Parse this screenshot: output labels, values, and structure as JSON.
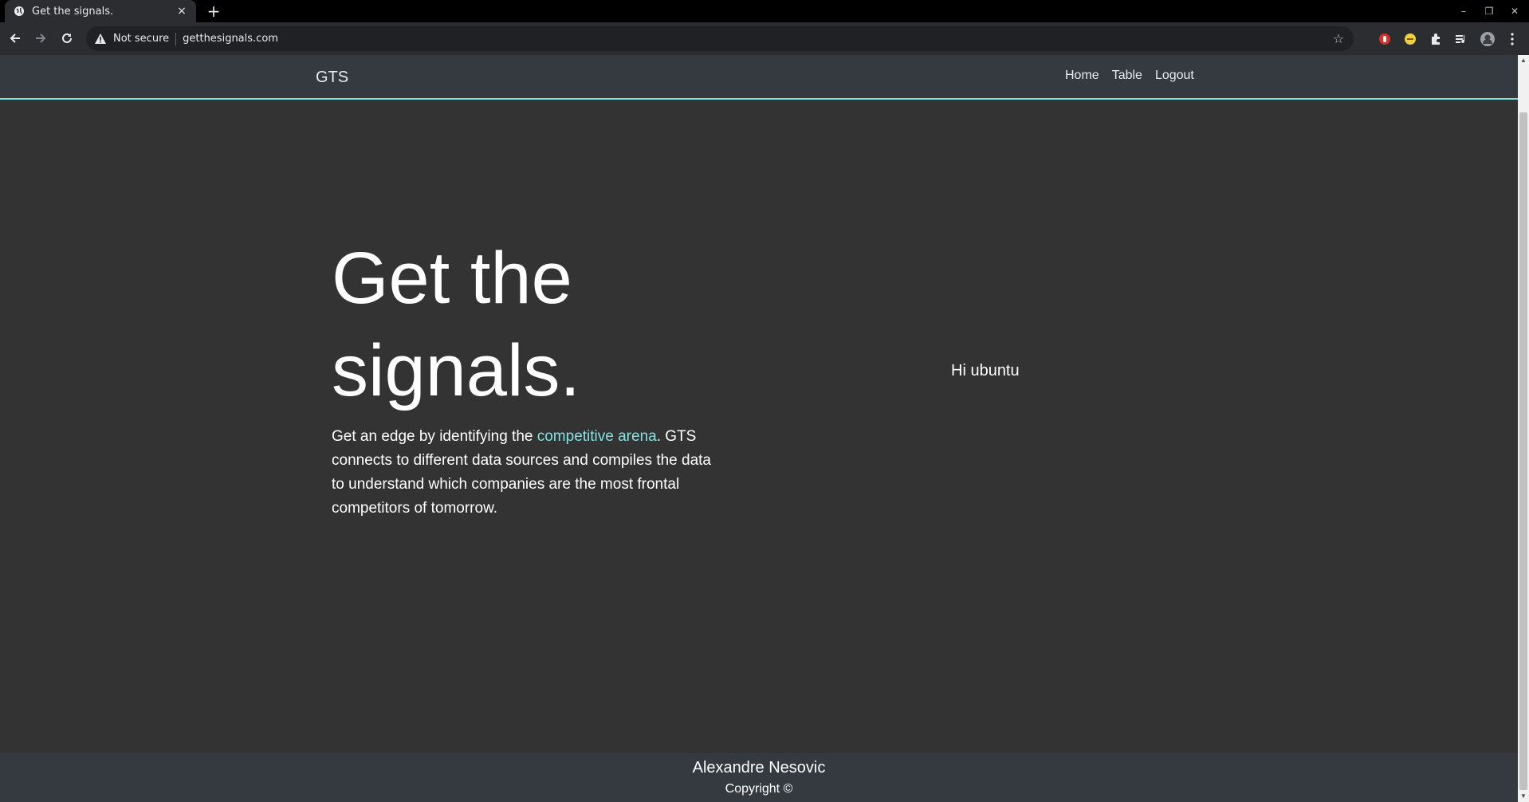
{
  "browser": {
    "tab_title": "Get the signals.",
    "tab_close": "×",
    "new_tab": "+",
    "security_label": "Not secure",
    "url": "getthesignals.com",
    "window_controls": {
      "minimize": "–",
      "restore": "❐",
      "close": "✕"
    },
    "icons": [
      "globe-icon",
      "back-icon",
      "forward-icon",
      "reload-icon",
      "warning-icon",
      "star-icon",
      "extension-icon",
      "profile-icon",
      "menu-icon"
    ]
  },
  "site": {
    "brand": "GTS",
    "nav": [
      {
        "label": "Home"
      },
      {
        "label": "Table"
      },
      {
        "label": "Logout"
      }
    ],
    "hero": {
      "title_line1": "Get the",
      "title_line2": "signals.",
      "body_before": "Get an edge by identifying the ",
      "body_highlight": "competitive arena",
      "body_after": ". GTS connects to different data sources and compiles the data to understand which companies are the most frontal competitors of tomorrow."
    },
    "greeting": "Hi ubuntu",
    "footer": {
      "author": "Alexandre Nesovic",
      "copyright": "Copyright ©"
    }
  },
  "colors": {
    "page_bg": "#333333",
    "navbar_bg": "#343a40",
    "accent": "#7fe3e3",
    "text": "#ffffff"
  }
}
